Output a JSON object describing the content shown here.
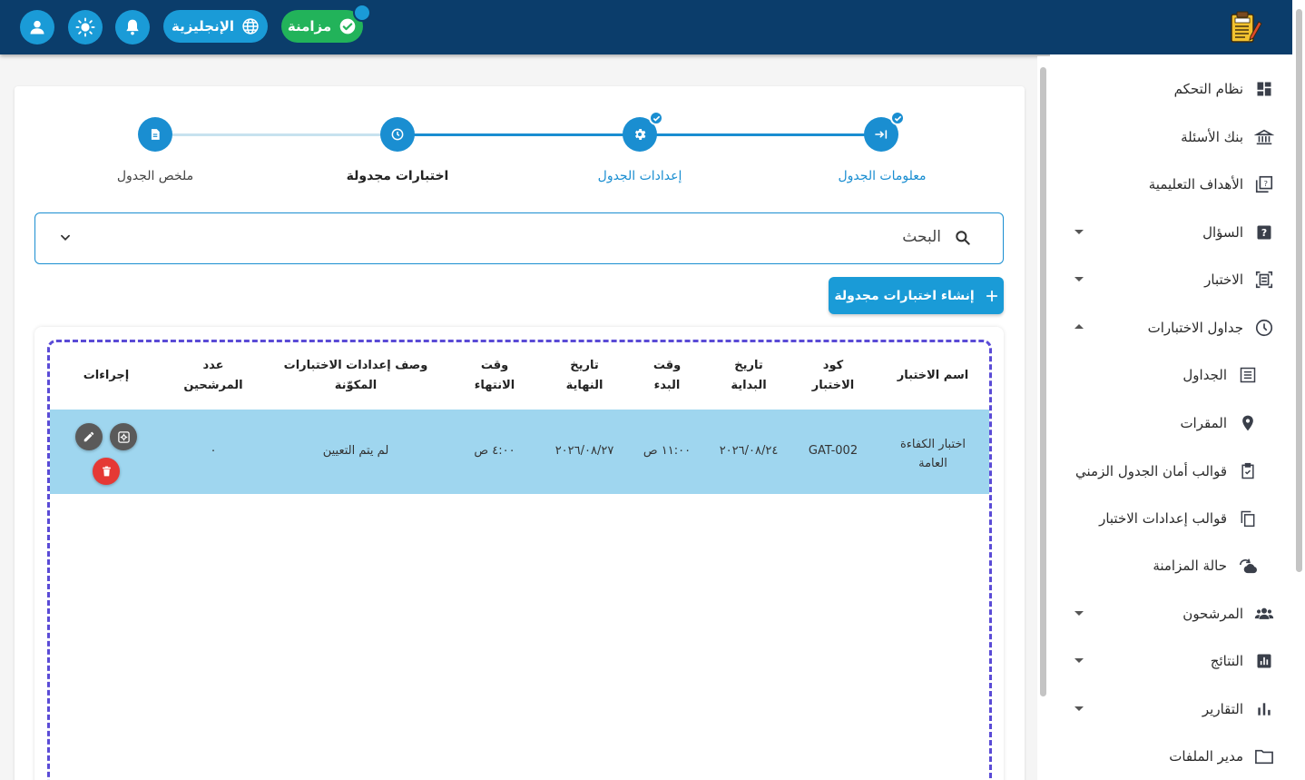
{
  "header": {
    "sync_label": "مزامنة",
    "language_label": "الإنجليزية"
  },
  "sidebar": {
    "items": [
      {
        "label": "نظام التحكم"
      },
      {
        "label": "بنك الأسئلة"
      },
      {
        "label": "الأهداف التعليمية"
      },
      {
        "label": "السؤال"
      },
      {
        "label": "الاختبار"
      },
      {
        "label": "جداول الاختبارات"
      },
      {
        "label": "الجداول"
      },
      {
        "label": "المقرات"
      },
      {
        "label": "قوالب أمان الجدول الزمني"
      },
      {
        "label": "قوالب إعدادات الاختبار"
      },
      {
        "label": "حالة المزامنة"
      },
      {
        "label": "المرشحون"
      },
      {
        "label": "النتائج"
      },
      {
        "label": "التقارير"
      },
      {
        "label": "مدير الملفات"
      }
    ]
  },
  "stepper": {
    "steps": [
      {
        "label": "معلومات الجدول"
      },
      {
        "label": "إعدادات الجدول"
      },
      {
        "label": "اختبارات مجدولة"
      },
      {
        "label": "ملخص الجدول"
      }
    ]
  },
  "search": {
    "label": "البحث"
  },
  "create_button": {
    "label": "إنشاء اختبارات مجدولة"
  },
  "table": {
    "headers": [
      {
        "line1": "اسم الاختبار",
        "line2": ""
      },
      {
        "line1": "كود",
        "line2": "الاختبار"
      },
      {
        "line1": "تاريخ",
        "line2": "البداية"
      },
      {
        "line1": "وقت",
        "line2": "البدء"
      },
      {
        "line1": "تاريخ",
        "line2": "النهاية"
      },
      {
        "line1": "وقت",
        "line2": "الانتهاء"
      },
      {
        "line1": "وصف إعدادات الاختبارات",
        "line2": "المكوّنة"
      },
      {
        "line1": "عدد",
        "line2": "المرشحين"
      },
      {
        "line1": "إجراءات",
        "line2": ""
      }
    ],
    "rows": [
      {
        "name_line1": "اختبار الكفاءة",
        "name_line2": "العامة",
        "code": "GAT-002",
        "start_date": "٢٠٢٦/٠٨/٢٤",
        "start_time": "١١:٠٠ ص",
        "end_date": "٢٠٢٦/٠٨/٢٧",
        "end_time": "٤:٠٠ ص",
        "settings_desc": "لم يتم التعيين",
        "candidates": "٠"
      }
    ]
  }
}
